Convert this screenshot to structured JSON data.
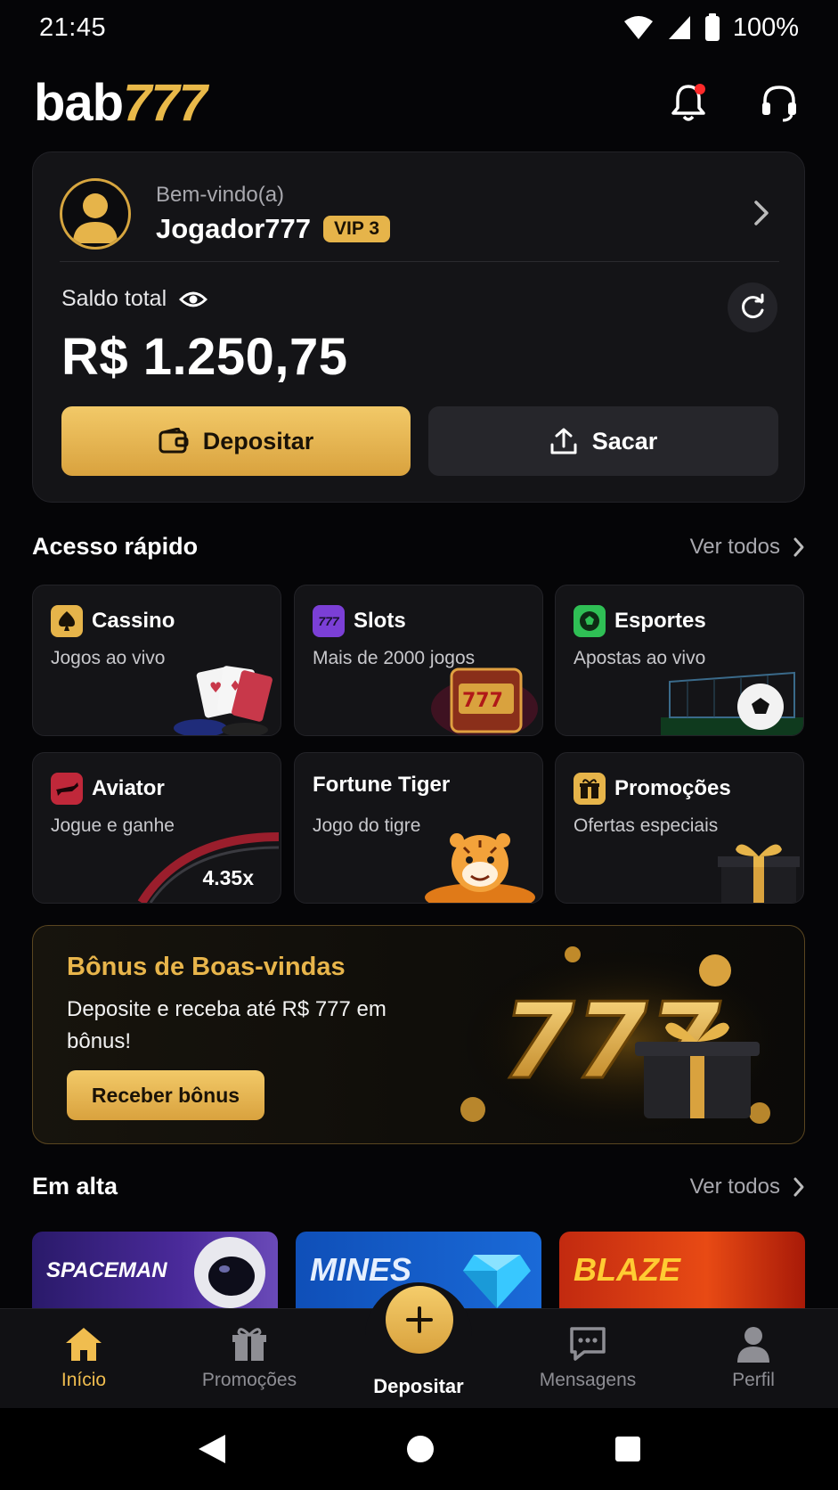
{
  "status": {
    "time": "21:45",
    "battery": "100%"
  },
  "header": {
    "logo_main": "bab",
    "logo_num": "777"
  },
  "account": {
    "welcome": "Bem-vindo(a)",
    "username": "Jogador777",
    "vip": "VIP 3",
    "balance_label": "Saldo total",
    "balance": "R$ 1.250,75",
    "deposit_label": "Depositar",
    "withdraw_label": "Sacar"
  },
  "quick": {
    "title": "Acesso rápido",
    "see_all": "Ver todos",
    "items": [
      {
        "title": "Cassino",
        "subtitle": "Jogos ao vivo",
        "icon": "spade-icon"
      },
      {
        "title": "Slots",
        "subtitle": "Mais de 2000 jogos",
        "icon": "slots-777-icon"
      },
      {
        "title": "Esportes",
        "subtitle": "Apostas ao vivo",
        "icon": "soccer-ball-icon"
      },
      {
        "title": "Aviator",
        "subtitle": "Jogue e ganhe",
        "icon": "airplane-icon",
        "multiplier": "4.35x"
      },
      {
        "title": "Fortune Tiger",
        "subtitle": "Jogo do tigre"
      },
      {
        "title": "Promoções",
        "subtitle": "Ofertas especiais",
        "icon": "gift-icon"
      }
    ]
  },
  "bonus": {
    "title": "Bônus de Boas-vindas",
    "text": "Deposite e receba até R$ 777 em bônus!",
    "button": "Receber bônus",
    "art_number": "777"
  },
  "trending": {
    "title": "Em alta",
    "see_all": "Ver todos",
    "games": [
      "SPACEMAN",
      "MINES",
      "BLAZE"
    ]
  },
  "nav": {
    "items": [
      {
        "label": "Início",
        "icon": "home-icon",
        "active": true
      },
      {
        "label": "Promoções",
        "icon": "gift-icon"
      },
      {
        "label": "Depositar",
        "icon": "plus-icon"
      },
      {
        "label": "Mensagens",
        "icon": "chat-icon"
      },
      {
        "label": "Perfil",
        "icon": "person-icon"
      }
    ]
  },
  "colors": {
    "accent": "#E8B54B",
    "background": "#050507",
    "card": "#141417"
  }
}
